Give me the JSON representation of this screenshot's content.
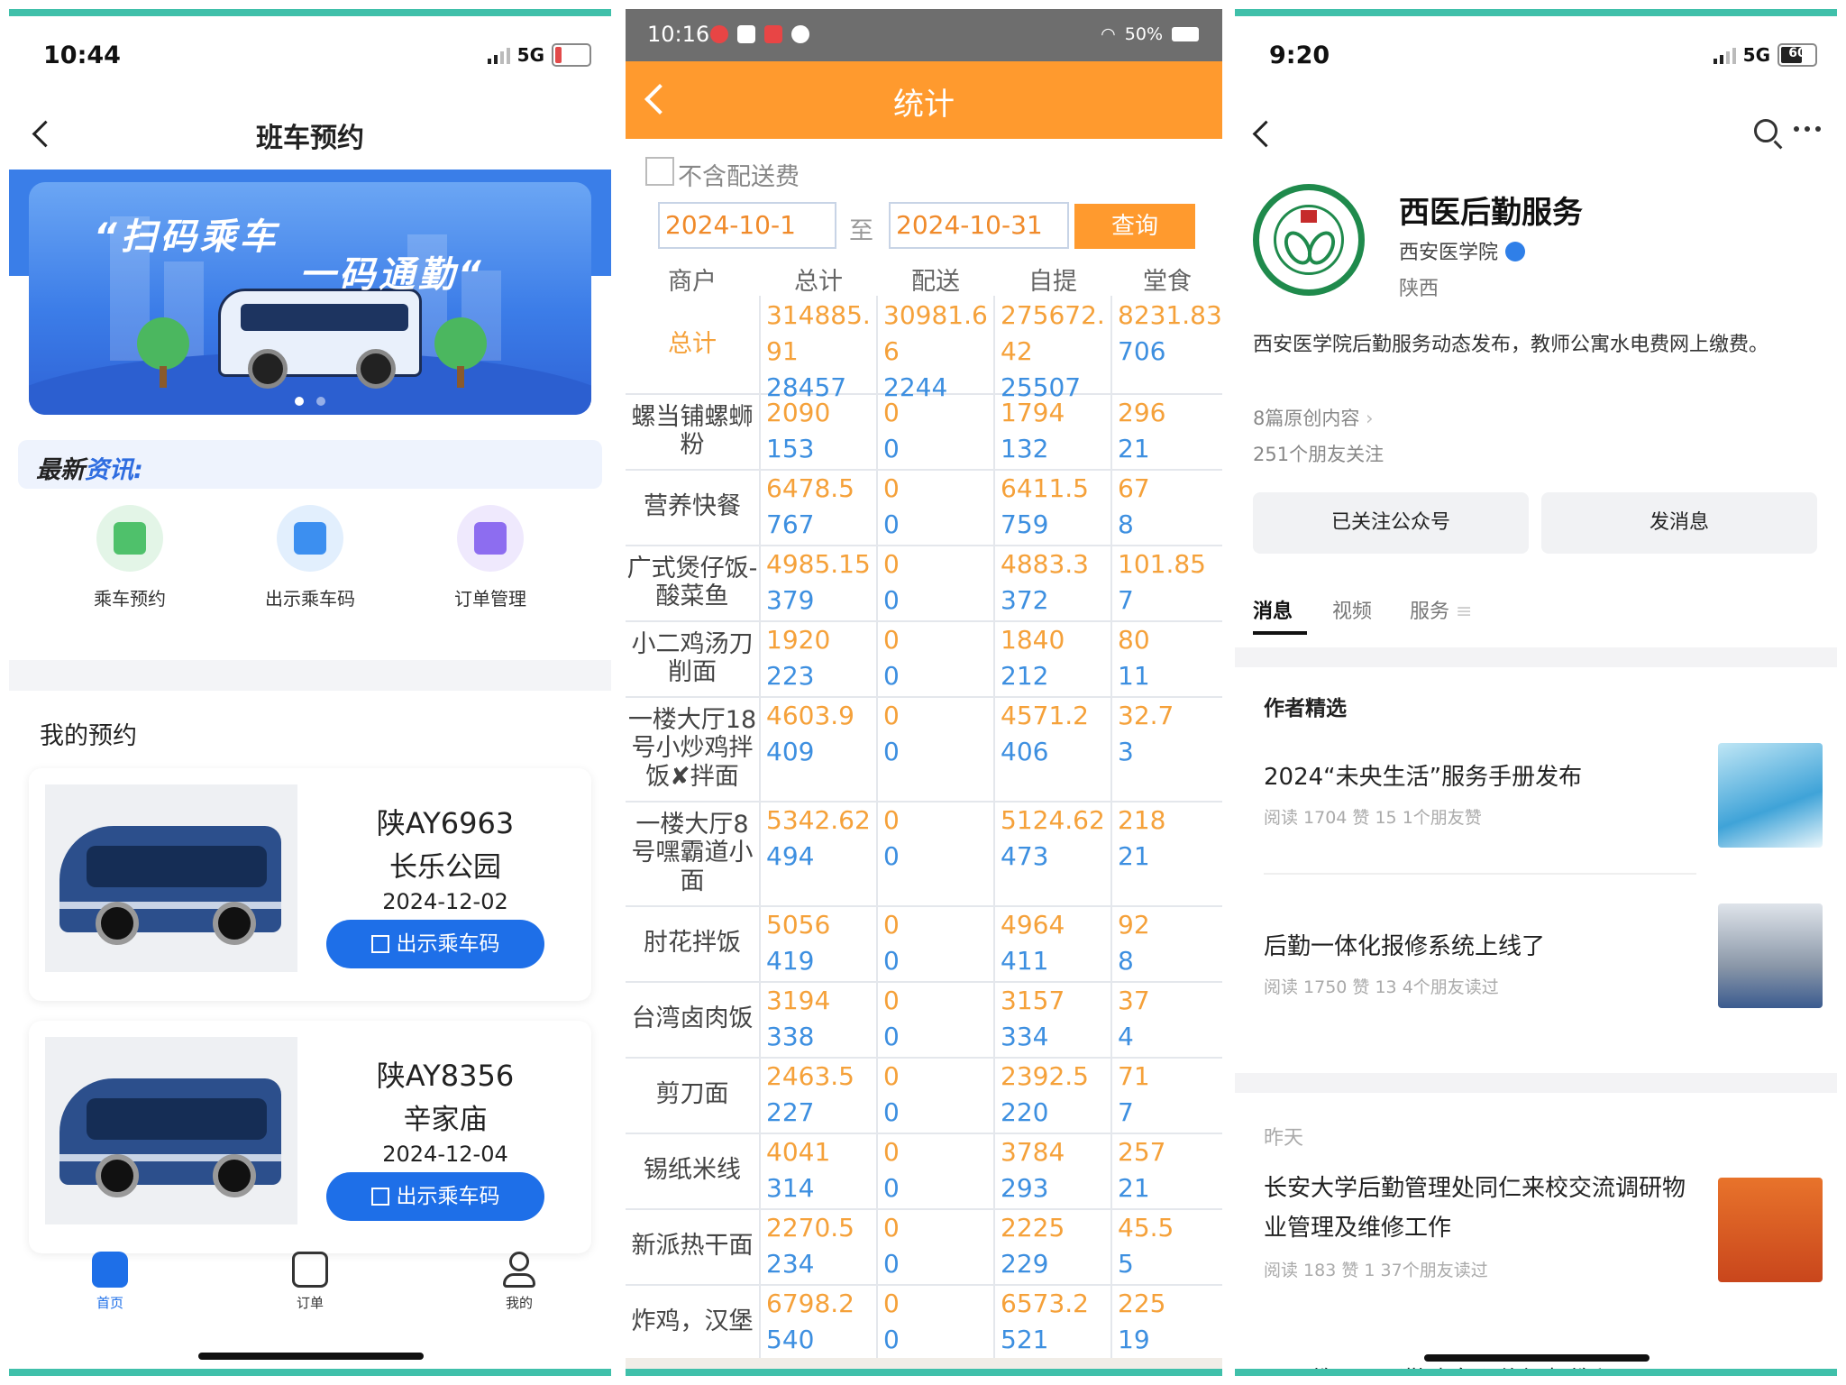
{
  "panel1": {
    "status": {
      "time": "10:44",
      "network": "5G",
      "battery": "19"
    },
    "title": "班车预约",
    "banner": {
      "line1": "“扫码乘车",
      "line2": "一码通勤“"
    },
    "news_label_a": "最新",
    "news_label_b": "资讯:",
    "grid": [
      {
        "label": "乘车预约",
        "icon": "calendar-icon",
        "color": "#4fc16b"
      },
      {
        "label": "出示乘车码",
        "icon": "bus-icon",
        "color": "#3c8ff0"
      },
      {
        "label": "订单管理",
        "icon": "clipboard-icon",
        "color": "#8d6df0"
      }
    ],
    "my_reservations": "我的预约",
    "cards": [
      {
        "plate": "陕AY6963",
        "stop": "长乐公园",
        "date": "2024-12-02",
        "button": "出示乘车码"
      },
      {
        "plate": "陕AY8356",
        "stop": "辛家庙",
        "date": "2024-12-04",
        "button": "出示乘车码"
      }
    ],
    "tabbar": [
      {
        "label": "首页",
        "icon": "home-icon",
        "active": true
      },
      {
        "label": "订单",
        "icon": "order-icon",
        "active": false
      },
      {
        "label": "我的",
        "icon": "profile-icon",
        "active": false
      }
    ]
  },
  "panel2": {
    "status": {
      "time": "10:16",
      "right": "50%"
    },
    "title": "统计",
    "checkbox_label": "不含配送费",
    "start_date": "2024-10-1",
    "to": "至",
    "end_date": "2024-10-31",
    "query": "查询",
    "headers": [
      "商户",
      "总计",
      "配送",
      "自提",
      "堂食"
    ],
    "rows": [
      {
        "name": "总计",
        "total": [
          "314885.",
          "91",
          "28457"
        ],
        "delivery": [
          "30981.6",
          "6",
          "2244"
        ],
        "pickup": [
          "275672.",
          "42",
          "25507"
        ],
        "dine": [
          "8231.83",
          "706"
        ]
      },
      {
        "name": "螺当铺螺蛳粉",
        "total": [
          "2090",
          "153"
        ],
        "delivery": [
          "0",
          "0"
        ],
        "pickup": [
          "1794",
          "132"
        ],
        "dine": [
          "296",
          "21"
        ]
      },
      {
        "name": "营养快餐",
        "total": [
          "6478.5",
          "767"
        ],
        "delivery": [
          "0",
          "0"
        ],
        "pickup": [
          "6411.5",
          "759"
        ],
        "dine": [
          "67",
          "8"
        ]
      },
      {
        "name": "广式煲仔饭-酸菜鱼",
        "total": [
          "4985.15",
          "379"
        ],
        "delivery": [
          "0",
          "0"
        ],
        "pickup": [
          "4883.3",
          "372"
        ],
        "dine": [
          "101.85",
          "7"
        ]
      },
      {
        "name": "小二鸡汤刀削面",
        "total": [
          "1920",
          "223"
        ],
        "delivery": [
          "0",
          "0"
        ],
        "pickup": [
          "1840",
          "212"
        ],
        "dine": [
          "80",
          "11"
        ]
      },
      {
        "name": "一楼大厅18号小炒鸡拌饭✘拌面",
        "total": [
          "4603.9",
          "409"
        ],
        "delivery": [
          "0",
          "0"
        ],
        "pickup": [
          "4571.2",
          "406"
        ],
        "dine": [
          "32.7",
          "3"
        ]
      },
      {
        "name": "一楼大厅8号嘿霸道小面",
        "total": [
          "5342.62",
          "494"
        ],
        "delivery": [
          "0",
          "0"
        ],
        "pickup": [
          "5124.62",
          "473"
        ],
        "dine": [
          "218",
          "21"
        ]
      },
      {
        "name": "肘花拌饭",
        "total": [
          "5056",
          "419"
        ],
        "delivery": [
          "0",
          "0"
        ],
        "pickup": [
          "4964",
          "411"
        ],
        "dine": [
          "92",
          "8"
        ]
      },
      {
        "name": "台湾卤肉饭",
        "total": [
          "3194",
          "338"
        ],
        "delivery": [
          "0",
          "0"
        ],
        "pickup": [
          "3157",
          "334"
        ],
        "dine": [
          "37",
          "4"
        ]
      },
      {
        "name": "剪刀面",
        "total": [
          "2463.5",
          "227"
        ],
        "delivery": [
          "0",
          "0"
        ],
        "pickup": [
          "2392.5",
          "220"
        ],
        "dine": [
          "71",
          "7"
        ]
      },
      {
        "name": "锡纸米线",
        "total": [
          "4041",
          "314"
        ],
        "delivery": [
          "0",
          "0"
        ],
        "pickup": [
          "3784",
          "293"
        ],
        "dine": [
          "257",
          "21"
        ]
      },
      {
        "name": "新派热干面",
        "total": [
          "2270.5",
          "234"
        ],
        "delivery": [
          "0",
          "0"
        ],
        "pickup": [
          "2225",
          "229"
        ],
        "dine": [
          "45.5",
          "5"
        ]
      },
      {
        "name": "炸鸡，汉堡",
        "total": [
          "6798.2",
          "540"
        ],
        "delivery": [
          "0",
          "0"
        ],
        "pickup": [
          "6573.2",
          "521"
        ],
        "dine": [
          "225",
          "19"
        ]
      }
    ]
  },
  "panel3": {
    "status": {
      "time": "9:20",
      "network": "5G",
      "battery": "60"
    },
    "account_name": "西医后勤服务",
    "org": "西安医学院",
    "region": "陕西",
    "description": "西安医学院后勤服务动态发布，教师公寓水电费网上缴费。",
    "original_count": "8篇原创内容",
    "friends": "251个朋友关注",
    "followed_btn": "已关注公众号",
    "message_btn": "发消息",
    "tabs": [
      "消息",
      "视频",
      "服务"
    ],
    "featured_title": "作者精选",
    "featured": [
      {
        "title": "2024“未央生活”服务手册发布",
        "meta": "阅读 1704  赞 15  1个朋友赞"
      },
      {
        "title": "后勤一体化报修系统上线了",
        "meta": "阅读 1750  赞 13  4个朋友读过"
      }
    ],
    "yesterday": "昨天",
    "recent": [
      {
        "title": "长安大学后勤管理处同仁来校交流调研物业管理及维修工作",
        "meta": "阅读 183  赞 1  37个朋友读过"
      }
    ],
    "cut_title": "西医教职工通勤班车预约视频教程"
  }
}
